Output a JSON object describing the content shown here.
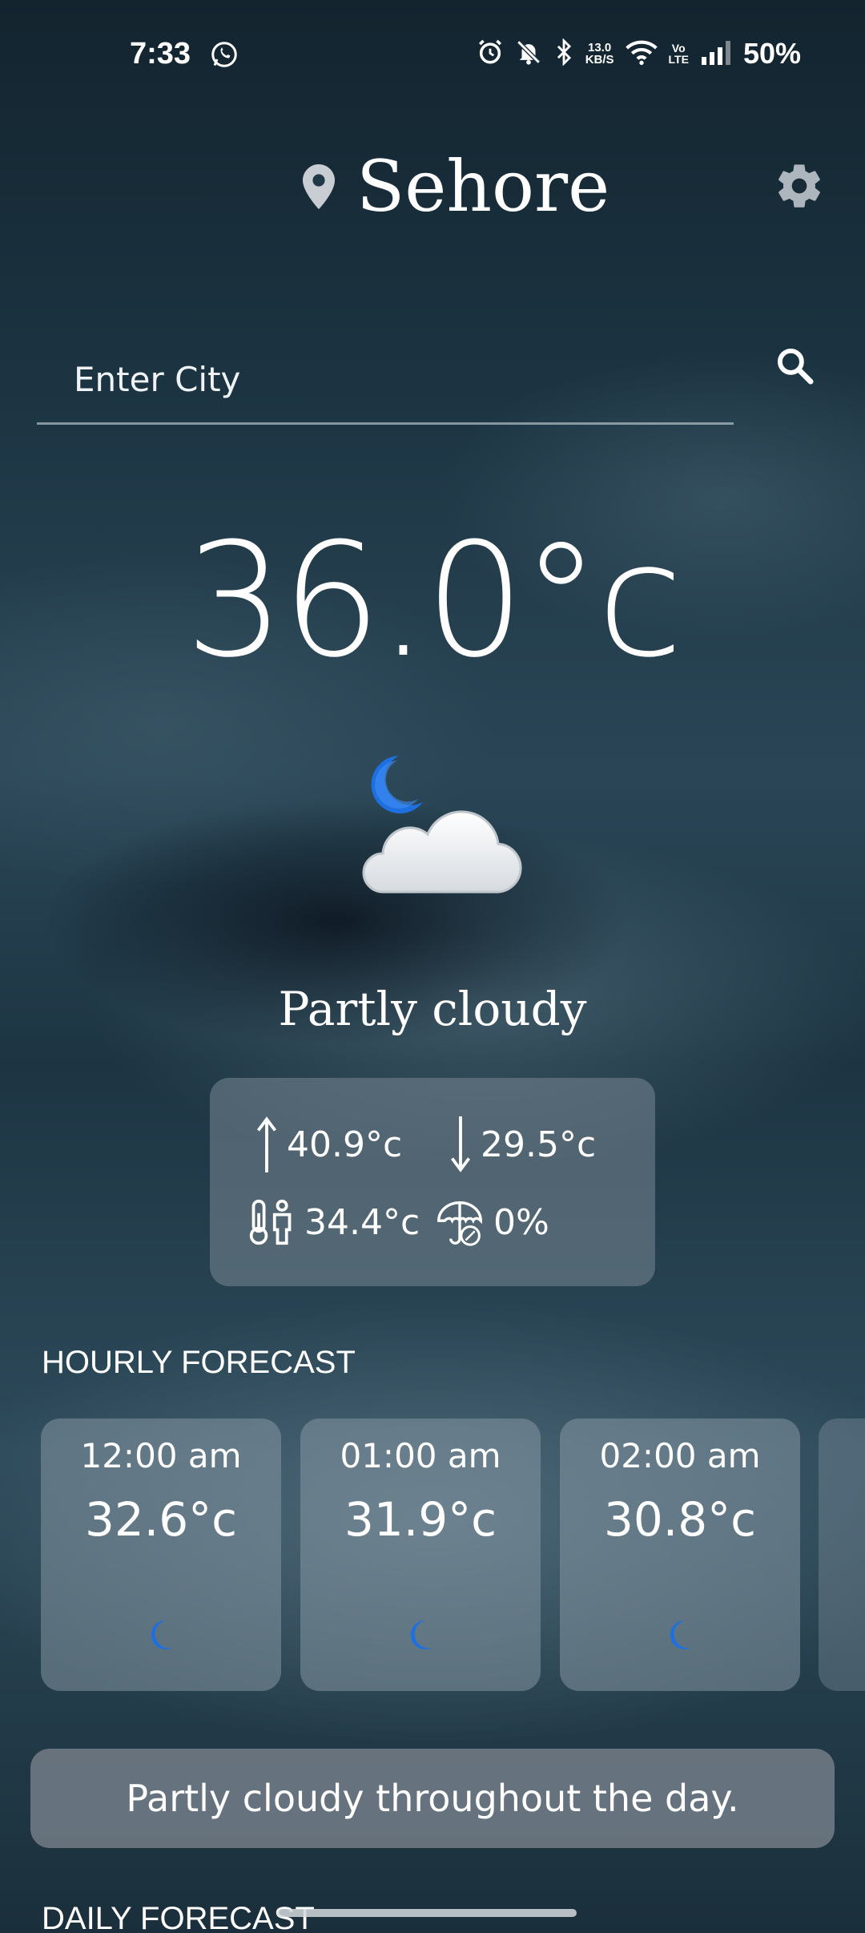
{
  "status_bar": {
    "time": "7:33",
    "net_speed_value": "13.0",
    "net_speed_unit": "KB/S",
    "volte_line1": "Vo",
    "volte_line2": "LTE",
    "battery": "50%"
  },
  "header": {
    "city": "Sehore"
  },
  "search": {
    "placeholder": "Enter City"
  },
  "current": {
    "temperature": "36.0°c",
    "condition": "Partly cloudy",
    "icon": "partly-cloudy-night-icon",
    "high": "40.9°c",
    "low": "29.5°c",
    "feels_like": "34.4°c",
    "precip_chance": "0%"
  },
  "hourly": {
    "title": "HOURLY FORECAST",
    "items": [
      {
        "time": "12:00 am",
        "temp": "32.6°c",
        "icon": "moon-icon"
      },
      {
        "time": "01:00 am",
        "temp": "31.9°c",
        "icon": "moon-icon"
      },
      {
        "time": "02:00 am",
        "temp": "30.8°c",
        "icon": "moon-icon"
      }
    ]
  },
  "summary": "Partly cloudy throughout the day.",
  "daily": {
    "title": "DAILY FORECAST"
  },
  "colors": {
    "moon_blue": "#1e6fe0",
    "text": "#ffffff"
  }
}
